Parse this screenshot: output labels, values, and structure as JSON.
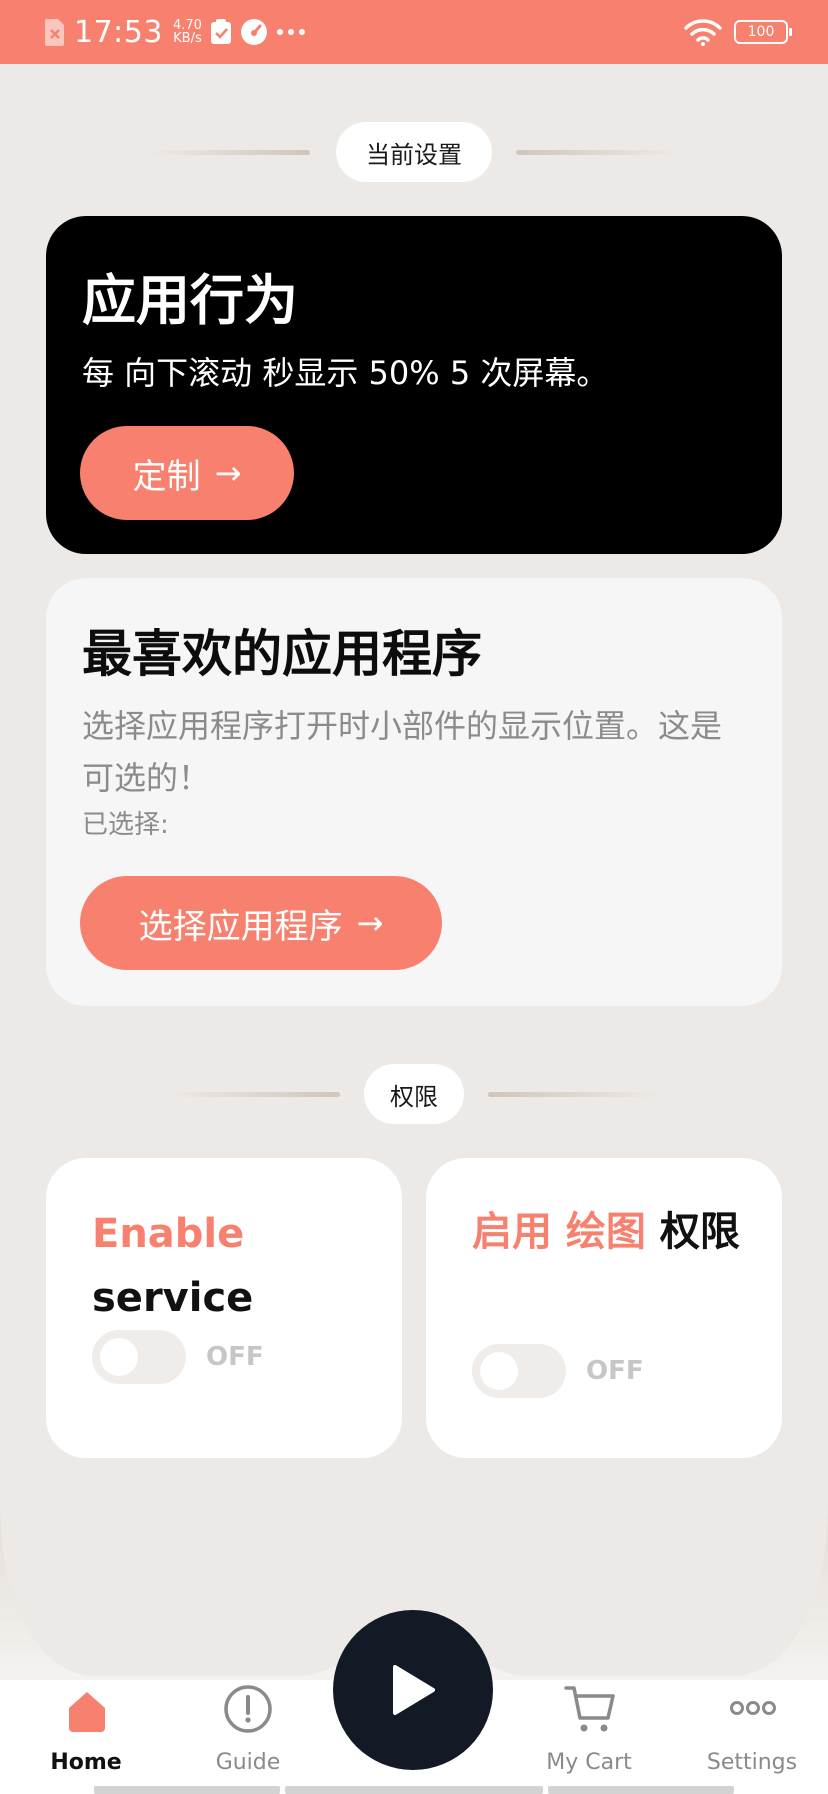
{
  "status_bar": {
    "time": "17:53",
    "speed_value": "4.70",
    "speed_unit": "KB/s",
    "battery": "100",
    "icons": [
      "sim-error-icon",
      "check-clipboard-icon",
      "speedometer-icon",
      "more-dots-icon",
      "wifi-icon",
      "battery-icon"
    ]
  },
  "current_settings": {
    "label": "当前设置"
  },
  "behavior_card": {
    "title": "应用行为",
    "description": "每 向下滚动 秒显示 50% 5 次屏幕。",
    "button_label": "定制",
    "button_arrow": "→"
  },
  "favorites_card": {
    "title": "最喜欢的应用程序",
    "description": "选择应用程序打开时小部件的显示位置。这是可选的！",
    "selected_label": "已选择:",
    "button_label": "选择应用程序",
    "button_arrow": "→"
  },
  "permissions": {
    "label": "权限",
    "service": {
      "accent": "Enable",
      "rest": "service",
      "state": "OFF"
    },
    "draw": {
      "accent": "启用 绘图",
      "rest": " 权限",
      "state": "OFF"
    }
  },
  "bottom_nav": {
    "items": [
      {
        "label": "Home",
        "icon": "home-icon"
      },
      {
        "label": "Guide",
        "icon": "info-circle-icon"
      },
      {
        "label": "My Cart",
        "icon": "cart-icon"
      },
      {
        "label": "Settings",
        "icon": "more-icon"
      }
    ],
    "play_icon": "play-icon"
  },
  "colors": {
    "accent": "#f7806e",
    "background": "#ede9e6",
    "dark_card": "#000000",
    "play_button": "#131a26"
  }
}
